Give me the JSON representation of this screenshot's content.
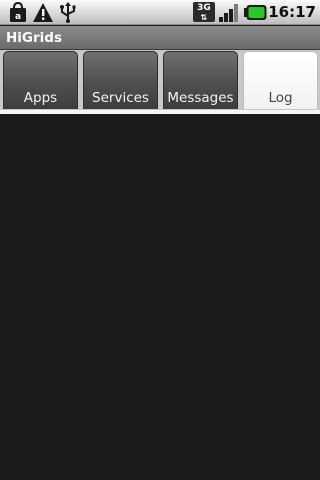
{
  "status_bar": {
    "time": "16:17",
    "network_type": "3G",
    "icons": [
      "bag-notification-icon",
      "warning-icon",
      "usb-icon",
      "network-3g-icon",
      "signal-strength-icon",
      "battery-icon"
    ]
  },
  "app": {
    "title": "HiGrids"
  },
  "tabs": [
    {
      "label": "Apps",
      "selected": false
    },
    {
      "label": "Services",
      "selected": false
    },
    {
      "label": "Messages",
      "selected": false
    },
    {
      "label": "Log",
      "selected": true
    }
  ],
  "colors": {
    "background": "#1a1a1a",
    "battery_green": "#22cc22"
  }
}
